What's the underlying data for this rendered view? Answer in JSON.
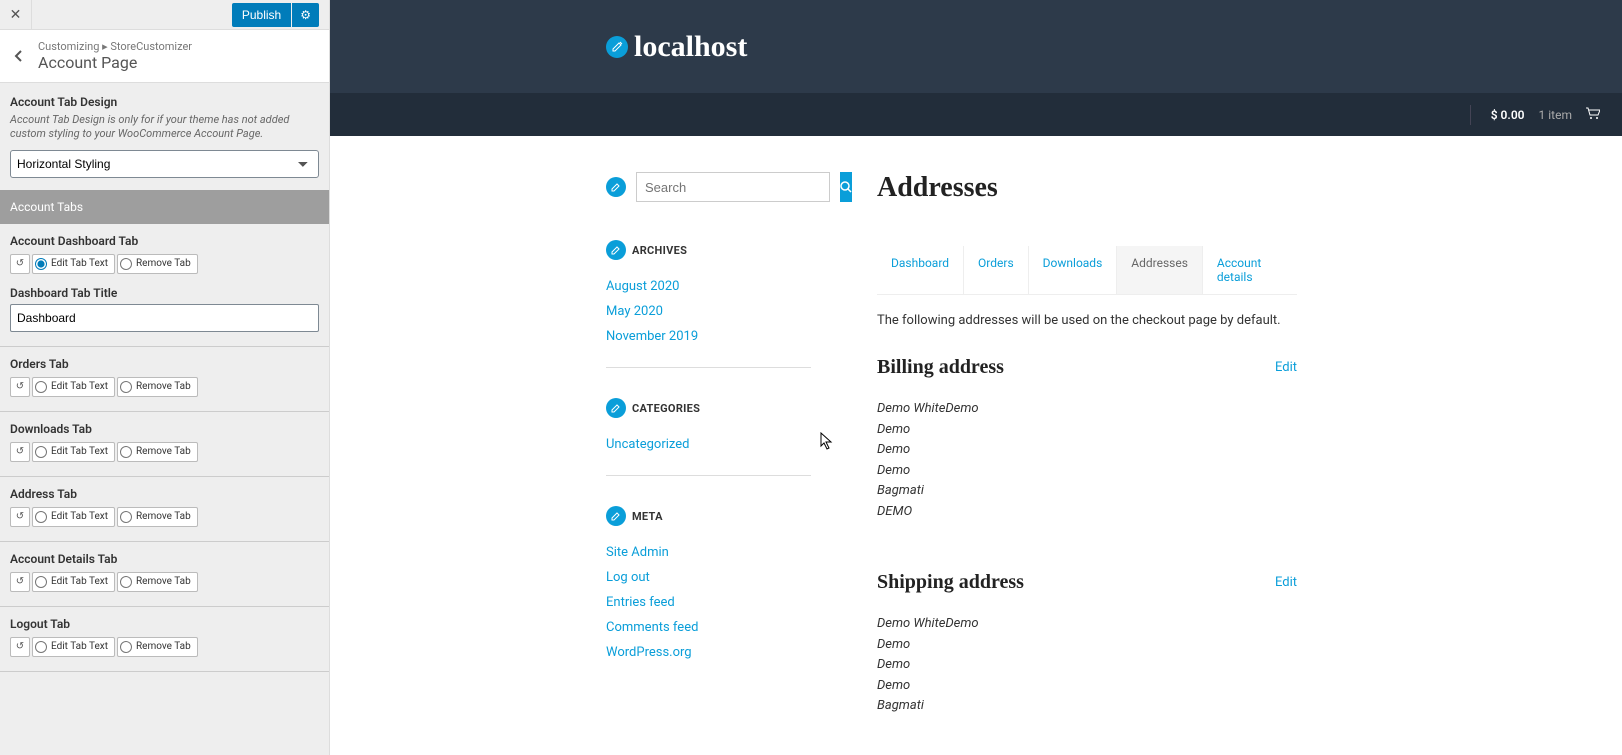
{
  "sidebar": {
    "publish": "Publish",
    "crumb": "Customizing ▸ StoreCustomizer",
    "title": "Account Page",
    "tab_design_label": "Account Tab Design",
    "tab_design_desc": "Account Tab Design is only for if your theme has not added custom styling to your WooCommerce Account Page.",
    "styling_value": "Horizontal Styling",
    "account_tabs_header": "Account Tabs",
    "edit_text_label": "Edit Tab Text",
    "remove_tab_label": "Remove Tab",
    "dashboard_title_label": "Dashboard Tab Title",
    "dashboard_title_value": "Dashboard",
    "tabs": [
      {
        "label": "Account Dashboard Tab",
        "selected": "edit"
      },
      {
        "label": "Orders Tab",
        "selected": "none"
      },
      {
        "label": "Downloads Tab",
        "selected": "none"
      },
      {
        "label": "Address Tab",
        "selected": "none"
      },
      {
        "label": "Account Details Tab",
        "selected": "none"
      },
      {
        "label": "Logout Tab",
        "selected": "none"
      }
    ]
  },
  "site": {
    "brand": "localhost",
    "cart_price": "$ 0.00",
    "cart_items": "1 item"
  },
  "search": {
    "placeholder": "Search"
  },
  "widgets": {
    "archives": {
      "title": "ARCHIVES",
      "items": [
        "August 2020",
        "May 2020",
        "November 2019"
      ]
    },
    "categories": {
      "title": "CATEGORIES",
      "items": [
        "Uncategorized"
      ]
    },
    "meta": {
      "title": "META",
      "items": [
        "Site Admin",
        "Log out",
        "Entries feed",
        "Comments feed",
        "WordPress.org"
      ]
    }
  },
  "page": {
    "title": "Addresses",
    "tabs": [
      "Dashboard",
      "Orders",
      "Downloads",
      "Addresses",
      "Account details"
    ],
    "active_tab": "Addresses",
    "desc": "The following addresses will be used on the checkout page by default.",
    "edit_label": "Edit",
    "billing_title": "Billing address",
    "shipping_title": "Shipping address",
    "billing": [
      "Demo WhiteDemo",
      "Demo",
      "Demo",
      "Demo",
      "Bagmati",
      "DEMO"
    ],
    "shipping": [
      "Demo WhiteDemo",
      "Demo",
      "Demo",
      "Demo",
      "Bagmati"
    ]
  }
}
